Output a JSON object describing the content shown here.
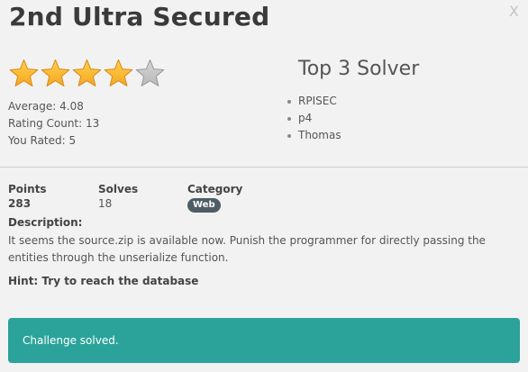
{
  "challenge": {
    "title": "2nd Ultra Secured",
    "close_label": "X"
  },
  "rating": {
    "stars_filled": 4,
    "stars_total": 5,
    "average_text": "Average: 4.08",
    "count_text": "Rating Count: 13",
    "you_rated_text": "You Rated: 5",
    "colors": {
      "filled": "#f5a623",
      "empty": "#b8b8b8"
    }
  },
  "solvers": {
    "heading": "Top 3 Solver",
    "names": [
      "RPISEC",
      "p4",
      "Thomas"
    ]
  },
  "stats": {
    "points_label": "Points",
    "points_value": "283",
    "solves_label": "Solves",
    "solves_value": "18",
    "category_label": "Category",
    "category_value": "Web"
  },
  "description": {
    "label": "Description:",
    "text": "It seems the source.zip is available now. Punish the programmer for directly passing the entities through the unserialize function.",
    "hint": "Hint: Try to reach the database"
  },
  "status": {
    "message": "Challenge solved.",
    "color": "#2ba39a"
  }
}
